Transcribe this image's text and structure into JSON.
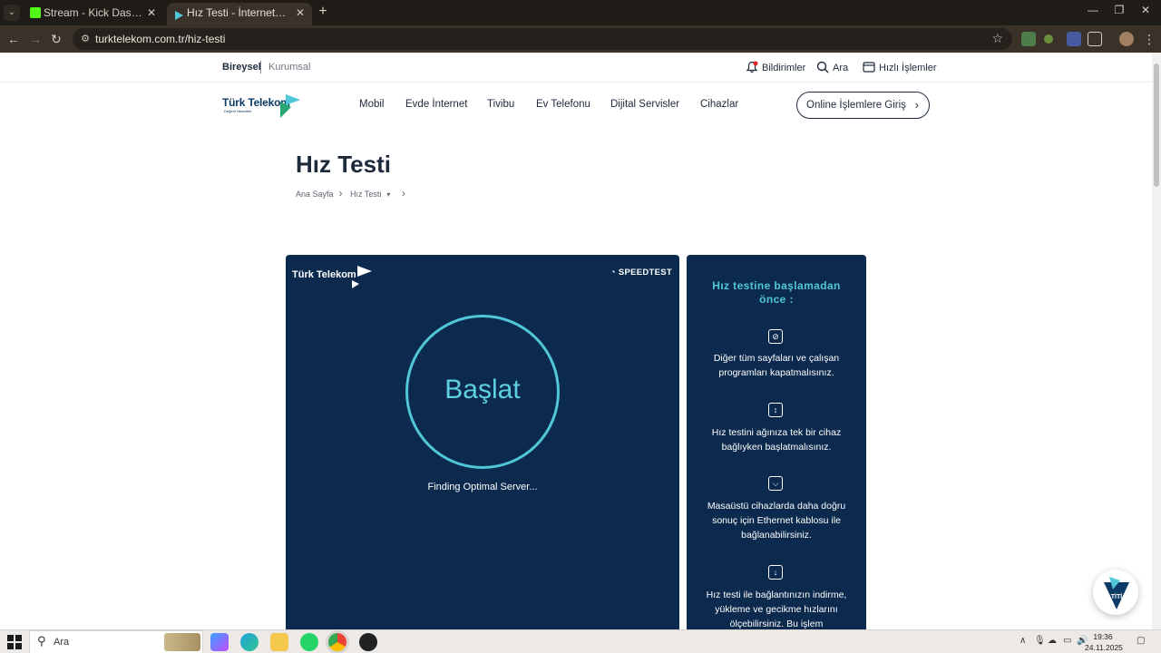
{
  "browser": {
    "tabs": [
      {
        "title": "Stream - Kick Dashboard",
        "active": false,
        "favicon_color": "#53fc18"
      },
      {
        "title": "Hız Testi - İnternet Hız Testi & S",
        "active": true,
        "favicon_color": "#4fc7d8"
      }
    ],
    "url": "turktelekom.com.tr/hiz-testi"
  },
  "site": {
    "segments": {
      "bireysel": "Bireysel",
      "kurumsal": "Kurumsal"
    },
    "utilities": {
      "notifications": "Bildirimler",
      "search": "Ara",
      "quick": "Hızlı İşlemler"
    },
    "logo_text": "Türk Telekom",
    "logo_tagline": "Değerli Hissettirir",
    "nav": [
      "Mobil",
      "Evde İnternet",
      "Tivibu",
      "Ev Telefonu",
      "Dijital Servisler",
      "Cihazlar"
    ],
    "online_button": "Online İşlemlere Giriş",
    "page_title": "Hız Testi",
    "breadcrumb": [
      "Ana Sayfa",
      "Hız Testi"
    ]
  },
  "speedtest": {
    "logo_text": "Türk Telekom",
    "brand": "SPEEDTEST",
    "start_label": "Başlat",
    "status": "Finding Optimal Server..."
  },
  "tips": {
    "title": "Hız testine başlamadan önce :",
    "items": [
      {
        "icon": "monitor-off-icon",
        "text": "Diğer tüm sayfaları ve çalışan programları kapatmalısınız."
      },
      {
        "icon": "device-icon",
        "text": "Hız testini ağınıza tek bir cihaz bağlıyken başlatmalısınız."
      },
      {
        "icon": "ethernet-icon",
        "text": "Masaüstü cihazlarda daha doğru sonuç için Ethernet kablosu ile bağlanabilirsiniz."
      },
      {
        "icon": "download-icon",
        "text": "Hız testi ile bağlantınızın indirme, yükleme ve gecikme hızlarını ölçebilirsiniz. Bu işlem"
      }
    ]
  },
  "chat": {
    "label": "TİTİ"
  },
  "taskbar": {
    "search_placeholder": "Ara",
    "time": "19:36",
    "date": "24.11.2025"
  },
  "colors": {
    "panel_bg": "#0c2a4d",
    "accent_cyan": "#4fc7d8",
    "text_dark": "#1d2a3b"
  }
}
